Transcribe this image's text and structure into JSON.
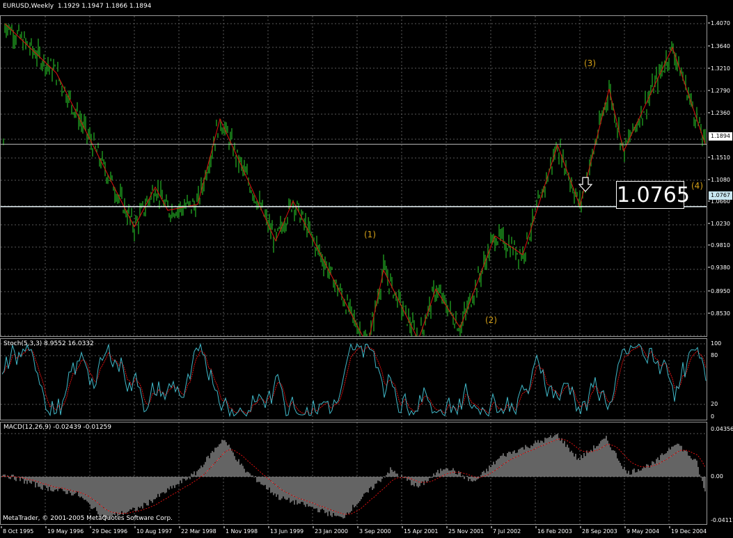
{
  "header": {
    "symbol": "EURUSD,Weekly",
    "ohlc": "1.1929 1.1947 1.1866 1.1894"
  },
  "main_chart": {
    "price_axis": [
      "1.4070",
      "1.3640",
      "1.3210",
      "1.2790",
      "1.2360",
      "1.1510",
      "1.1080",
      "1.0660",
      "1.0230",
      "0.9810",
      "0.9380",
      "0.8950",
      "0.8530"
    ],
    "current_price": "1.1894",
    "level_price": "1.0767",
    "level_big": "1.0765",
    "wave_labels": [
      "(1)",
      "(2)",
      "(3)",
      "(4)"
    ],
    "colors": {
      "candle": "#1f9a1f",
      "zigzag": "#e01010",
      "grid": "#5a5a5a",
      "wave": "#d4a017"
    }
  },
  "stoch": {
    "label": "Stoch(5,3,3) 8.9552 16.0332",
    "axis": [
      "100",
      "80",
      "20",
      "0"
    ],
    "colors": {
      "main": "#40b8c8",
      "signal": "#e01010"
    }
  },
  "macd": {
    "label": "MACD(12,26,9) -0.02439 -0.01259",
    "axis": [
      "0.04356",
      "0.00",
      "-0.04111"
    ],
    "colors": {
      "hist": "#c8c8c8",
      "signal": "#e01010"
    }
  },
  "time_axis": [
    "8 Oct 1995",
    "19 May 1996",
    "29 Dec 1996",
    "10 Aug 1997",
    "22 Mar 1998",
    "1 Nov 1998",
    "13 Jun 1999",
    "23 Jan 2000",
    "3 Sep 2000",
    "15 Apr 2001",
    "25 Nov 2001",
    "7 Jul 2002",
    "16 Feb 2003",
    "28 Sep 2003",
    "9 May 2004",
    "19 Dec 2004"
  ],
  "copyright": "MetaTrader, © 2001-2005 MetaQuotes Software Corp."
}
